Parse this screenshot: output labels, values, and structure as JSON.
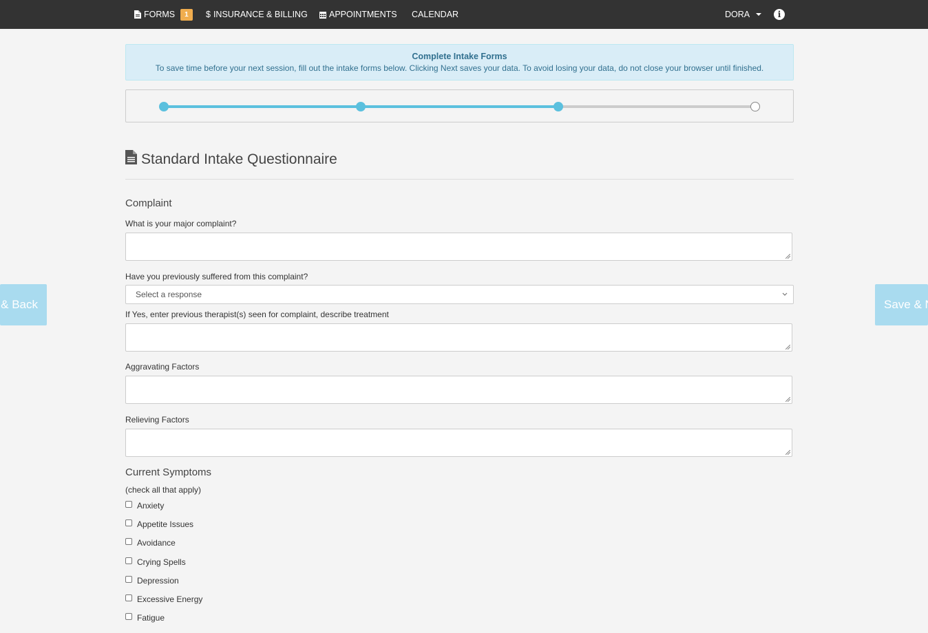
{
  "nav": {
    "forms_label": "FORMS",
    "forms_badge": "1",
    "insurance_label": "INSURANCE & BILLING",
    "insurance_prefix": "$",
    "appointments_label": "APPOINTMENTS",
    "calendar_label": "CALENDAR",
    "user_label": "DORA"
  },
  "alert": {
    "title": "Complete Intake Forms",
    "text": "To save time before your next session, fill out the intake forms below. Clicking Next saves your data. To avoid losing your data, do not close your browser until finished."
  },
  "progress": {
    "total_steps": 4,
    "current_step": 3
  },
  "page_title": "Standard Intake Questionnaire",
  "complaint": {
    "section_title": "Complaint",
    "major_label": "What is your major complaint?",
    "major_value": "",
    "previous_label": "Have you previously suffered from this complaint?",
    "previous_placeholder": "Select a response",
    "therapists_label": "If Yes, enter previous therapist(s) seen for complaint, describe treatment",
    "therapists_value": "",
    "aggravating_label": "Aggravating Factors",
    "aggravating_value": "",
    "relieving_label": "Relieving Factors",
    "relieving_value": ""
  },
  "symptoms": {
    "section_title": "Current Symptoms",
    "hint": "(check all that apply)",
    "items": [
      "Anxiety",
      "Appetite Issues",
      "Avoidance",
      "Crying Spells",
      "Depression",
      "Excessive Energy",
      "Fatigue"
    ]
  },
  "buttons": {
    "back": "& Back",
    "next": "Save & N"
  },
  "colors": {
    "accent": "#5bc0de",
    "nav_bg": "#333333",
    "alert_bg": "#d9edf7",
    "badge": "#f0ad4e",
    "side_button": "#a9dbef"
  }
}
